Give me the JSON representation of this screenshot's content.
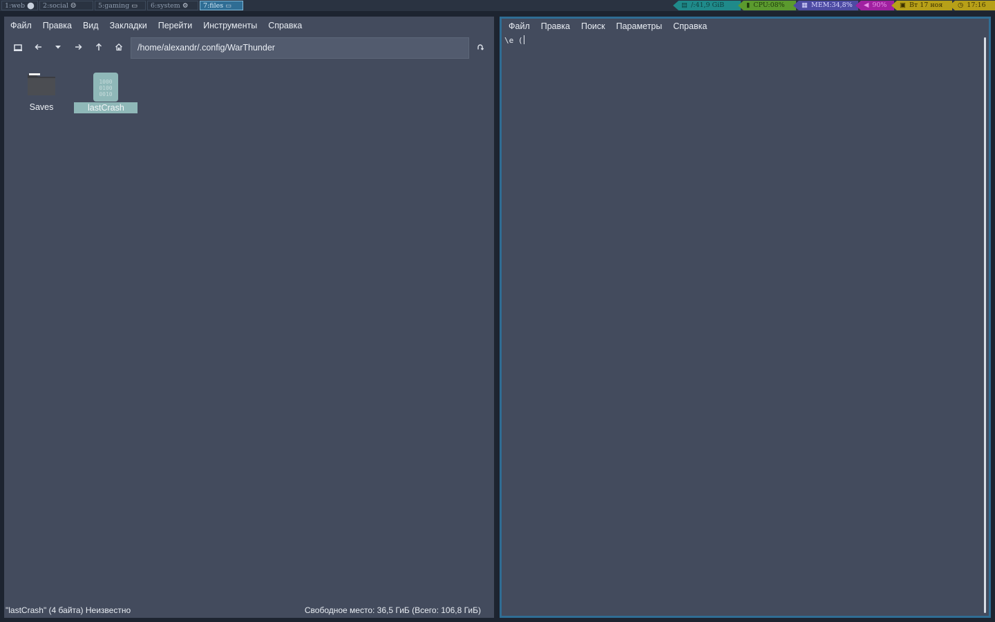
{
  "topbar": {
    "workspaces": [
      {
        "label": "1:web",
        "icon": "globe-icon",
        "glyph": "⬤",
        "active": false
      },
      {
        "label": "2:social",
        "icon": "users-icon",
        "glyph": "☺",
        "active": false
      },
      {
        "label": "5:gaming",
        "icon": "gamepad-icon",
        "glyph": "▭",
        "active": false
      },
      {
        "label": "6:system",
        "icon": "gear-icon",
        "glyph": "⚙",
        "active": false
      },
      {
        "label": "7:files",
        "icon": "folder-icon",
        "glyph": "▭",
        "active": true
      }
    ],
    "status": {
      "disk": {
        "text": "/:41,9 GiB",
        "icon": "hdd-icon",
        "glyph": "▤",
        "bg": "#1f8a8a",
        "fg": "#0d3f3f"
      },
      "cpu": {
        "text": "CPU:08%",
        "icon": "cpu-icon",
        "glyph": "▮",
        "bg": "#5b9a2e",
        "fg": "#1e3b0c"
      },
      "mem": {
        "text": "MEM:34,8%",
        "icon": "memory-icon",
        "glyph": "▦",
        "bg": "#4d4ba3",
        "fg": "#d8d6ff"
      },
      "vol": {
        "text": "90%",
        "icon": "volume-icon",
        "glyph": "◀",
        "bg": "#a020a0",
        "fg": "#e890e8"
      },
      "date": {
        "text": "Вт 17 ноя",
        "icon": "calendar-icon",
        "glyph": "▣",
        "bg": "#b7a018",
        "fg": "#3b3000"
      },
      "time": {
        "text": "17:16",
        "icon": "clock-icon",
        "glyph": "◷",
        "bg": "#b7a018",
        "fg": "#3b3000"
      }
    }
  },
  "file_manager": {
    "menu": [
      "Файл",
      "Правка",
      "Вид",
      "Закладки",
      "Перейти",
      "Инструменты",
      "Справка"
    ],
    "path": "/home/alexandr/.config/WarThunder",
    "items": [
      {
        "name": "Saves",
        "type": "folder",
        "selected": false
      },
      {
        "name": "lastCrash",
        "type": "binary-file",
        "selected": true,
        "icon_text": "1000\n0100\n0010"
      }
    ],
    "status_left": "\"lastCrash\" (4 байта) Неизвестно",
    "status_right": "Свободное место: 36,5 ГиБ (Всего: 106,8 ГиБ)"
  },
  "editor": {
    "menu": [
      "Файл",
      "Правка",
      "Поиск",
      "Параметры",
      "Справка"
    ],
    "content": "\\e ("
  }
}
